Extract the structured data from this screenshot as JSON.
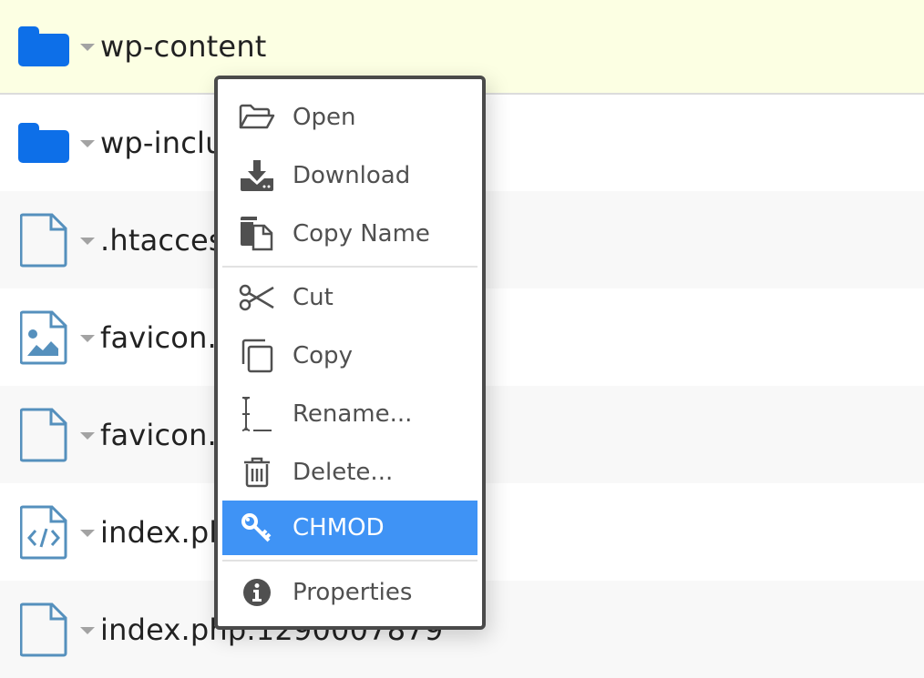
{
  "colors": {
    "selected_row_bg": "#fcffe3",
    "folder_blue": "#0d6fe8",
    "file_icon_blue": "#5590bd",
    "menu_highlight": "#3f93f5",
    "menu_border": "#4a4a4a"
  },
  "files": [
    {
      "name": "wp-content",
      "icon": "folder-icon",
      "selected": true
    },
    {
      "name": "wp-inclu",
      "icon": "folder-icon"
    },
    {
      "name": ".htacces",
      "icon": "file-icon"
    },
    {
      "name": "favicon.",
      "icon": "image-file-icon"
    },
    {
      "name": "favicon.",
      "icon": "file-icon"
    },
    {
      "name": "index.ph",
      "icon": "code-file-icon"
    },
    {
      "name": "index.php.1290007879",
      "icon": "file-icon"
    }
  ],
  "context_menu": {
    "items": [
      {
        "label": "Open",
        "icon": "folder-open-icon"
      },
      {
        "label": "Download",
        "icon": "download-icon"
      },
      {
        "label": "Copy Name",
        "icon": "copy-name-icon"
      },
      {
        "label": "Cut",
        "icon": "scissors-icon"
      },
      {
        "label": "Copy",
        "icon": "copy-icon"
      },
      {
        "label": "Rename...",
        "icon": "rename-cursor-icon"
      },
      {
        "label": "Delete...",
        "icon": "trash-icon"
      },
      {
        "label": "CHMOD",
        "icon": "key-icon",
        "highlighted": true
      },
      {
        "label": "Properties",
        "icon": "info-icon"
      }
    ]
  }
}
